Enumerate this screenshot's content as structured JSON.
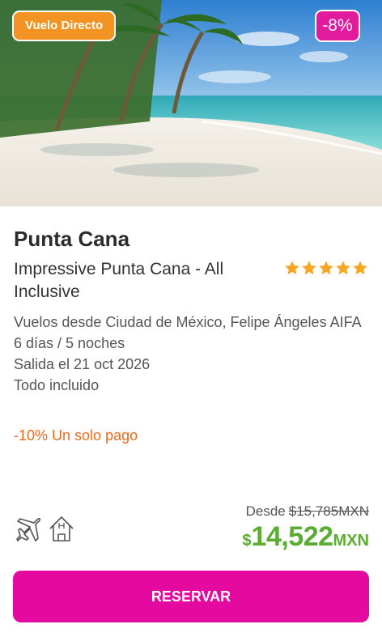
{
  "badges": {
    "direct_flight": "Vuelo Directo",
    "discount": "-8%"
  },
  "destination": "Punta Cana",
  "hotel": {
    "name": "Impressive Punta Cana - All Inclusive",
    "stars": 5
  },
  "details": {
    "flights": "Vuelos desde Ciudad de México, Felipe Ángeles AIFA",
    "duration": "6 días / 5 noches",
    "departure": "Salida el 21 oct 2026",
    "plan": "Todo incluido"
  },
  "promo": "-10% Un solo pago",
  "includes_icons": [
    "airplane-icon",
    "hotel-icon"
  ],
  "price": {
    "from_label": "Desde",
    "old_price": "$15,785MXN",
    "currency_symbol": "$",
    "amount": "14,522",
    "unit": "MXN"
  },
  "cta": {
    "label": "RESERVAR"
  },
  "colors": {
    "accent": "#e40aa0",
    "badge_orange": "#f39323",
    "price_green": "#5aac32",
    "promo_orange": "#ef6a1c",
    "star": "#f5a623"
  }
}
